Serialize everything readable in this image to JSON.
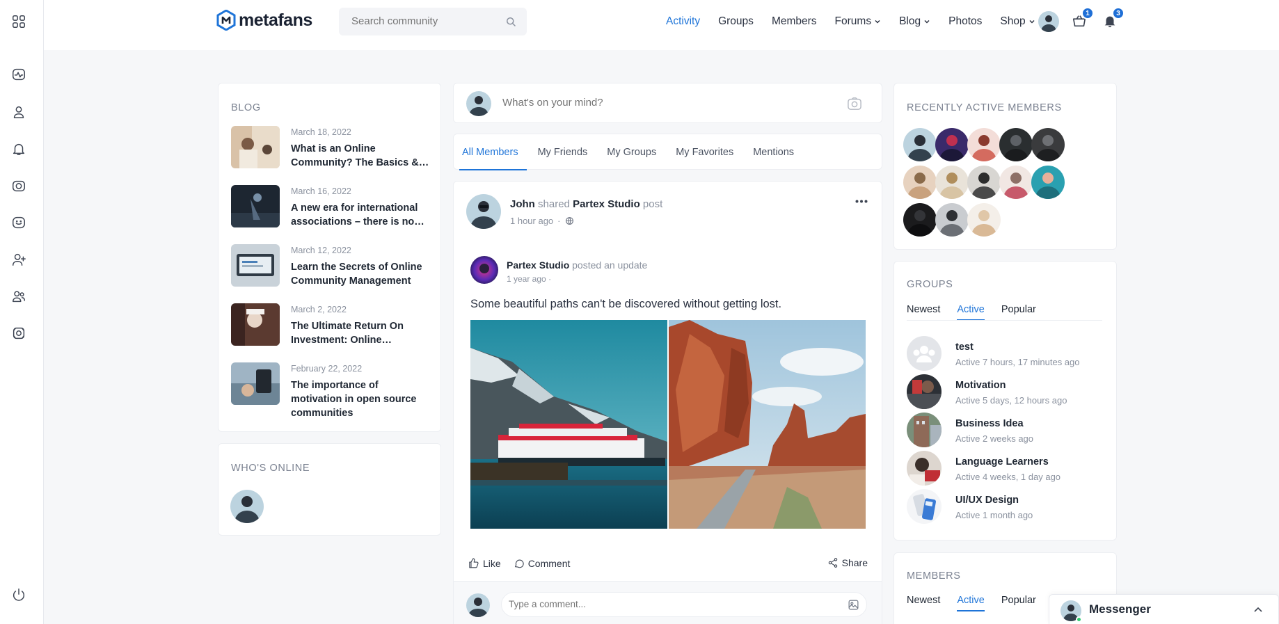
{
  "brand": {
    "name": "metafans",
    "accent": "#1e74d8"
  },
  "search": {
    "placeholder": "Search community"
  },
  "nav": [
    {
      "label": "Activity",
      "active": true,
      "dropdown": false
    },
    {
      "label": "Groups",
      "active": false,
      "dropdown": false
    },
    {
      "label": "Members",
      "active": false,
      "dropdown": false
    },
    {
      "label": "Forums",
      "active": false,
      "dropdown": true
    },
    {
      "label": "Blog",
      "active": false,
      "dropdown": true
    },
    {
      "label": "Photos",
      "active": false,
      "dropdown": false
    },
    {
      "label": "Shop",
      "active": false,
      "dropdown": true
    }
  ],
  "header": {
    "cart_count": "1",
    "notification_count": "3"
  },
  "rail": [
    "apps-grid-icon",
    "activity-icon",
    "user-icon",
    "bell-icon",
    "camera-icon",
    "chat-icon",
    "add-user-icon",
    "users-icon",
    "settings-icon",
    "power-icon"
  ],
  "blog": {
    "title": "BLOG",
    "items": [
      {
        "date": "March 18, 2022",
        "title": "What is an Online Community? The Basics &…"
      },
      {
        "date": "March 16, 2022",
        "title": "A new era for international associations – there is no…"
      },
      {
        "date": "March 12, 2022",
        "title": "Learn the Secrets of Online Community Management"
      },
      {
        "date": "March 2, 2022",
        "title": "The Ultimate Return On Investment: Online…"
      },
      {
        "date": "February 22, 2022",
        "title": "The importance of motivation in open source communities"
      }
    ]
  },
  "online": {
    "title": "WHO'S ONLINE"
  },
  "composer": {
    "placeholder": "What's on your mind?"
  },
  "feed_tabs": [
    {
      "label": "All Members",
      "active": true
    },
    {
      "label": "My Friends",
      "active": false
    },
    {
      "label": "My Groups",
      "active": false
    },
    {
      "label": "My Favorites",
      "active": false
    },
    {
      "label": "Mentions",
      "active": false
    }
  ],
  "post": {
    "author": "John",
    "action": "shared",
    "target": "Partex Studio",
    "target_suffix": "post",
    "time": "1 hour ago",
    "inner_author": "Partex Studio",
    "inner_action": "posted an update",
    "inner_time": "1 year ago",
    "text": "Some beautiful paths can't be discovered without getting lost.",
    "like_label": "Like",
    "comment_label": "Comment",
    "share_label": "Share",
    "comment_placeholder": "Type a comment..."
  },
  "recent_members": {
    "title": "RECENTLY ACTIVE MEMBERS"
  },
  "groups": {
    "title": "GROUPS",
    "tabs": [
      {
        "label": "Newest",
        "active": false
      },
      {
        "label": "Active",
        "active": true
      },
      {
        "label": "Popular",
        "active": false
      }
    ],
    "items": [
      {
        "name": "test",
        "meta": "Active 7 hours, 17 minutes ago"
      },
      {
        "name": "Motivation",
        "meta": "Active 5 days, 12 hours ago"
      },
      {
        "name": "Business Idea",
        "meta": "Active 2 weeks ago"
      },
      {
        "name": "Language Learners",
        "meta": "Active 4 weeks, 1 day ago"
      },
      {
        "name": "UI/UX Design",
        "meta": "Active 1 month ago"
      }
    ]
  },
  "members": {
    "title": "MEMBERS",
    "tabs": [
      {
        "label": "Newest",
        "active": false
      },
      {
        "label": "Active",
        "active": true
      },
      {
        "label": "Popular",
        "active": false
      }
    ]
  },
  "messenger": {
    "label": "Messenger"
  }
}
